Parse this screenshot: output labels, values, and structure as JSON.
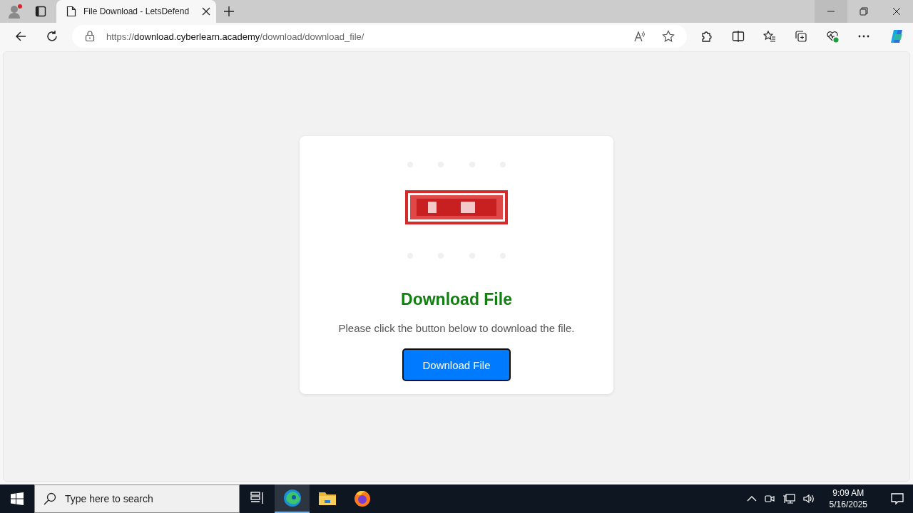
{
  "browser": {
    "tabs": [
      {
        "title": "File Download - LetsDefend",
        "selected": true
      }
    ],
    "address": {
      "scheme": "https://",
      "host": "download.cyberlearn.academy",
      "path": "/download/download_file/"
    }
  },
  "page": {
    "heading": "Download File",
    "message": "Please click the button below to download the file.",
    "button": "Download File"
  },
  "taskbar": {
    "search": {
      "placeholder": "Type here to search"
    },
    "apps": [
      {
        "kind": "taskview",
        "selected": false
      },
      {
        "kind": "edge",
        "selected": true
      },
      {
        "kind": "explorer",
        "selected": false
      },
      {
        "kind": "firefox",
        "selected": false
      }
    ],
    "time": "9:09 AM",
    "date": "5/16/2025"
  }
}
